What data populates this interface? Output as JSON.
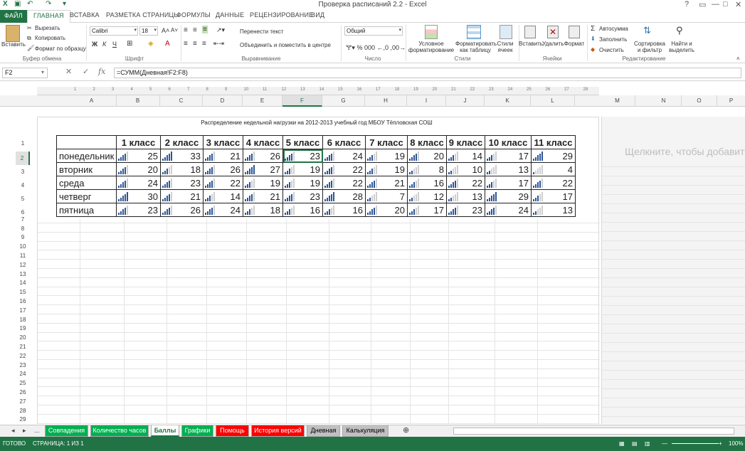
{
  "window": {
    "title": "Проверка расписаний 2.2 - Excel",
    "controls": [
      "?",
      "▭",
      "—",
      "□",
      "✕"
    ]
  },
  "ribbon_tabs": [
    "ФАЙЛ",
    "ГЛАВНАЯ",
    "ВСТАВКА",
    "РАЗМЕТКА СТРАНИЦЫ",
    "ФОРМУЛЫ",
    "ДАННЫЕ",
    "РЕЦЕНЗИРОВАНИЕ",
    "ВИД"
  ],
  "ribbon": {
    "clipboard": {
      "paste": "Вставить",
      "cut": "Вырезать",
      "copy": "Копировать",
      "format_painter": "Формат по образцу",
      "label": "Буфер обмена"
    },
    "font": {
      "name": "Calibri",
      "size": "18",
      "bold": "Ж",
      "italic": "К",
      "underline": "Ч",
      "label": "Шрифт"
    },
    "alignment": {
      "wrap": "Перенести текст",
      "merge": "Объединить и поместить в центре",
      "label": "Выравнивание"
    },
    "number": {
      "format": "Общий",
      "label": "Число"
    },
    "styles": {
      "conditional": [
        "Условное",
        "форматирование"
      ],
      "table": [
        "Форматировать",
        "как таблицу"
      ],
      "cell": [
        "Стили",
        "ячеек"
      ],
      "label": "Стили"
    },
    "cells": {
      "insert": "Вставить",
      "delete": "Удалить",
      "format": "Формат",
      "label": "Ячейки"
    },
    "editing": {
      "autosum": "Автосумма",
      "fill": "Заполнить",
      "clear": "Очистить",
      "sort": [
        "Сортировка",
        "и фильтр"
      ],
      "find": [
        "Найти и",
        "выделить"
      ],
      "label": "Редактирование"
    }
  },
  "formula_bar": {
    "name_box": "F2",
    "fx": "fx",
    "formula": "=СУММ(Дневная!F2:F8)"
  },
  "columns": [
    "A",
    "B",
    "C",
    "D",
    "E",
    "F",
    "G",
    "H",
    "I",
    "J",
    "K",
    "L",
    "M",
    "N",
    "O",
    "P"
  ],
  "rows": [
    "1",
    "2",
    "3",
    "4",
    "5",
    "6",
    "7",
    "8",
    "9",
    "10",
    "11",
    "12",
    "13",
    "14",
    "15",
    "16",
    "17",
    "18",
    "19",
    "20",
    "21",
    "22",
    "23",
    "24",
    "25",
    "26",
    "27",
    "28",
    "29"
  ],
  "ruler": [
    "1",
    "2",
    "3",
    "4",
    "5",
    "6",
    "7",
    "8",
    "9",
    "10",
    "11",
    "12",
    "13",
    "14",
    "15",
    "16",
    "17",
    "18",
    "19",
    "20",
    "21",
    "22",
    "23",
    "24",
    "25",
    "26",
    "27",
    "28"
  ],
  "sheet_title": "Распределение недельной нагрузки на 2012-2013 учебный год МБОУ Тёпловская СОШ",
  "click_to_add": "Щелкните, чтобы добавит",
  "table": {
    "headers": [
      "1 класс",
      "2 класс",
      "3 класс",
      "4 класс",
      "5 класс",
      "6 класс",
      "7 класс",
      "8 класс",
      "9 класс",
      "10 класс",
      "11 класс"
    ],
    "rows": [
      {
        "day": "понедельник",
        "values": [
          25,
          33,
          21,
          26,
          23,
          24,
          19,
          20,
          14,
          17,
          29
        ]
      },
      {
        "day": "вторник",
        "values": [
          20,
          18,
          26,
          27,
          19,
          22,
          19,
          8,
          10,
          13,
          4
        ]
      },
      {
        "day": "среда",
        "values": [
          24,
          23,
          22,
          19,
          19,
          22,
          21,
          16,
          22,
          17,
          22
        ]
      },
      {
        "day": "четверг",
        "values": [
          30,
          21,
          14,
          21,
          23,
          28,
          7,
          12,
          13,
          29,
          17
        ]
      },
      {
        "day": "пятница",
        "values": [
          23,
          26,
          24,
          18,
          16,
          16,
          20,
          17,
          23,
          24,
          13
        ]
      }
    ]
  },
  "sheet_tabs": [
    {
      "name": "Совпадения",
      "color": "#00b050"
    },
    {
      "name": "Количество часов",
      "color": "#00b050"
    },
    {
      "name": "Баллы",
      "color": "#ffffff",
      "active": true
    },
    {
      "name": "Графики",
      "color": "#00b050"
    },
    {
      "name": "Помощь",
      "color": "#ff0000"
    },
    {
      "name": "История версий",
      "color": "#ff0000"
    },
    {
      "name": "Дневная",
      "color": "#c0c0c0"
    },
    {
      "name": "Калькуляция",
      "color": "#c0c0c0"
    }
  ],
  "status": {
    "ready": "ГОТОВО",
    "page": "СТРАНИЦА: 1 ИЗ 1",
    "zoom": "100%"
  },
  "colors": {
    "excel_green": "#217346",
    "bar_on": "#2d5597",
    "bar_off": "#cfcfcf"
  }
}
